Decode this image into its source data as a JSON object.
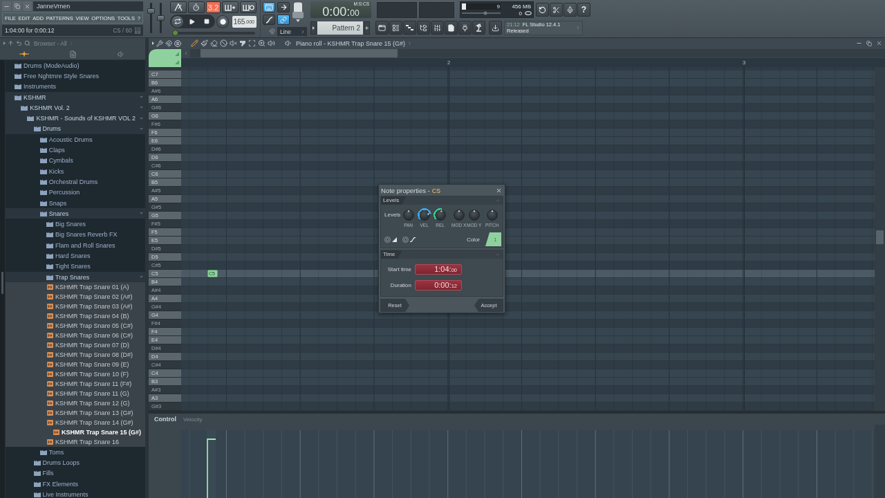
{
  "title_bar": {
    "user": "JanneVrnen"
  },
  "menu": [
    "FILE",
    "EDIT",
    "ADD",
    "PATTERNS",
    "VIEW",
    "OPTIONS",
    "TOOLS",
    "?"
  ],
  "hint_bar": {
    "text": "1:04:00 for 0:00:12",
    "note": "C5 / 60"
  },
  "master_sliders": [
    {
      "level": 0.78
    },
    {
      "level": 0.5
    }
  ],
  "transport": {
    "toggles": [
      {
        "on": false
      },
      {
        "on": false
      },
      {
        "label": "3.2",
        "on": true
      },
      {
        "on": false
      },
      {
        "on": false
      }
    ],
    "tempo": {
      "value": "165",
      "fraction": ".000"
    },
    "song_position": {
      "level": 0
    }
  },
  "snap": {
    "toggles": [
      {
        "on": true
      },
      {
        "on": false
      },
      {
        "on": false
      },
      {
        "on": true
      }
    ],
    "mode": "Line"
  },
  "time_display": {
    "value": "0:00:",
    "fraction": "00",
    "format": "M:S:CS"
  },
  "performance": {
    "cpu_meter": {
      "level": 0.1
    },
    "cpu": "9",
    "memory": "456 MB",
    "polyphony": "0"
  },
  "help": "?",
  "pattern": "Pattern 2",
  "hint_panel": {
    "time": "21:12",
    "title": "FL Studio 12.4.1",
    "status": "Released"
  },
  "browser": {
    "title": "Browser - All",
    "tabs": [
      {
        "selected": true
      },
      {
        "selected": false
      },
      {
        "selected": false
      }
    ],
    "tree": [
      {
        "label": "Drums (ModeAudio)",
        "kind": "folder",
        "expanded": false
      },
      {
        "label": "Free Nghtmre Style Snares",
        "kind": "folder",
        "expanded": false
      },
      {
        "label": "Instruments",
        "kind": "folder",
        "expanded": false
      },
      {
        "label": "KSHMR",
        "kind": "folder",
        "expanded": true,
        "children": [
          {
            "label": "KSHMR Vol. 2",
            "kind": "folder",
            "expanded": true,
            "children": [
              {
                "label": "KSHMR - Sounds of KSHMR VOL 2",
                "kind": "folder",
                "expanded": true,
                "children": [
                  {
                    "label": "Drums",
                    "kind": "folder",
                    "expanded": true,
                    "children": [
                      {
                        "label": "Acoustic Drums",
                        "kind": "folder",
                        "expanded": false
                      },
                      {
                        "label": "Claps",
                        "kind": "folder",
                        "expanded": false
                      },
                      {
                        "label": "Cymbals",
                        "kind": "folder",
                        "expanded": false
                      },
                      {
                        "label": "Kicks",
                        "kind": "folder",
                        "expanded": false
                      },
                      {
                        "label": "Orchestral Drums",
                        "kind": "folder",
                        "expanded": false
                      },
                      {
                        "label": "Percussion",
                        "kind": "folder",
                        "expanded": false
                      },
                      {
                        "label": "Snaps",
                        "kind": "folder",
                        "expanded": false
                      },
                      {
                        "label": "Snares",
                        "kind": "folder",
                        "expanded": true,
                        "children": [
                          {
                            "label": "Big Snares",
                            "kind": "folder",
                            "expanded": false
                          },
                          {
                            "label": "Big Snares Reverb FX",
                            "kind": "folder",
                            "expanded": false
                          },
                          {
                            "label": "Flam and Roll Snares",
                            "kind": "folder",
                            "expanded": false
                          },
                          {
                            "label": "Hard Snares",
                            "kind": "folder",
                            "expanded": false
                          },
                          {
                            "label": "Tight Snares",
                            "kind": "folder",
                            "expanded": false
                          },
                          {
                            "label": "Trap Snares",
                            "kind": "folder",
                            "expanded": true,
                            "children": [
                              {
                                "label": "KSHMR Trap Snare 01 (A)",
                                "kind": "file",
                                "selected": false
                              },
                              {
                                "label": "KSHMR Trap Snare 02 (A#)",
                                "kind": "file",
                                "selected": false
                              },
                              {
                                "label": "KSHMR Trap Snare 03 (A#)",
                                "kind": "file",
                                "selected": false
                              },
                              {
                                "label": "KSHMR Trap Snare 04 (B)",
                                "kind": "file",
                                "selected": false
                              },
                              {
                                "label": "KSHMR Trap Snare 05 (C#)",
                                "kind": "file",
                                "selected": false
                              },
                              {
                                "label": "KSHMR Trap Snare 06 (C#)",
                                "kind": "file",
                                "selected": false
                              },
                              {
                                "label": "KSHMR Trap Snare 07 (D)",
                                "kind": "file",
                                "selected": false
                              },
                              {
                                "label": "KSHMR Trap Snare 08 (D#)",
                                "kind": "file",
                                "selected": false
                              },
                              {
                                "label": "KSHMR Trap Snare 09 (E)",
                                "kind": "file",
                                "selected": false
                              },
                              {
                                "label": "KSHMR Trap Snare 10 (F)",
                                "kind": "file",
                                "selected": false
                              },
                              {
                                "label": "KSHMR Trap Snare 11 (F#)",
                                "kind": "file",
                                "selected": false
                              },
                              {
                                "label": "KSHMR Trap Snare 11 (G)",
                                "kind": "file",
                                "selected": false
                              },
                              {
                                "label": "KSHMR Trap Snare 12 (G)",
                                "kind": "file",
                                "selected": false
                              },
                              {
                                "label": "KSHMR Trap Snare 13 (G#)",
                                "kind": "file",
                                "selected": false
                              },
                              {
                                "label": "KSHMR Trap Snare 14 (G#)",
                                "kind": "file",
                                "selected": false
                              },
                              {
                                "label": "KSHMR Trap Snare 15 (G#)",
                                "kind": "file",
                                "selected": true
                              },
                              {
                                "label": "KSHMR Trap Snare 16",
                                "kind": "file",
                                "selected": false
                              }
                            ]
                          }
                        ]
                      },
                      {
                        "label": "Toms",
                        "kind": "folder",
                        "expanded": false
                      }
                    ]
                  },
                  {
                    "label": "Drums Loops",
                    "kind": "folder",
                    "expanded": false
                  },
                  {
                    "label": "Fills",
                    "kind": "folder",
                    "expanded": false
                  },
                  {
                    "label": "FX Elements",
                    "kind": "folder",
                    "expanded": false
                  },
                  {
                    "label": "Live Instruments",
                    "kind": "folder",
                    "expanded": false
                  }
                ]
              }
            ]
          }
        ]
      }
    ]
  },
  "piano_roll": {
    "title": "Piano roll - KSHMR Trap Snare 15 (G#)",
    "tools": [
      {
        "selected": true
      },
      {
        "selected": false
      },
      {
        "selected": false
      },
      {
        "selected": false
      },
      {
        "selected": false
      },
      {
        "selected": false
      },
      {
        "selected": false
      },
      {
        "selected": false
      },
      {
        "selected": false
      }
    ],
    "bars": [
      "2",
      "3"
    ],
    "keys": [
      {
        "label": "C7",
        "kind": "white",
        "selected": false
      },
      {
        "label": "B6",
        "kind": "white",
        "selected": false
      },
      {
        "label": "A#6",
        "kind": "black",
        "selected": false
      },
      {
        "label": "A6",
        "kind": "white",
        "selected": false
      },
      {
        "label": "G#6",
        "kind": "black",
        "selected": false
      },
      {
        "label": "G6",
        "kind": "white",
        "selected": false
      },
      {
        "label": "F#6",
        "kind": "black",
        "selected": false
      },
      {
        "label": "F6",
        "kind": "white",
        "selected": false
      },
      {
        "label": "E6",
        "kind": "white",
        "selected": false
      },
      {
        "label": "D#6",
        "kind": "black",
        "selected": false
      },
      {
        "label": "D6",
        "kind": "white",
        "selected": false
      },
      {
        "label": "C#6",
        "kind": "black",
        "selected": false
      },
      {
        "label": "C6",
        "kind": "white",
        "selected": false
      },
      {
        "label": "B5",
        "kind": "white",
        "selected": false
      },
      {
        "label": "A#5",
        "kind": "black",
        "selected": false
      },
      {
        "label": "A5",
        "kind": "white",
        "selected": false
      },
      {
        "label": "G#5",
        "kind": "black",
        "selected": false
      },
      {
        "label": "G5",
        "kind": "white",
        "selected": false
      },
      {
        "label": "F#5",
        "kind": "black",
        "selected": false
      },
      {
        "label": "F5",
        "kind": "white",
        "selected": false
      },
      {
        "label": "E5",
        "kind": "white",
        "selected": false
      },
      {
        "label": "D#5",
        "kind": "black",
        "selected": false
      },
      {
        "label": "D5",
        "kind": "white",
        "selected": false
      },
      {
        "label": "C#5",
        "kind": "black",
        "selected": false
      },
      {
        "label": "C5",
        "kind": "white",
        "selected": true,
        "notes": [
          {
            "label": "C5"
          }
        ]
      },
      {
        "label": "B4",
        "kind": "white",
        "selected": false
      },
      {
        "label": "A#4",
        "kind": "black",
        "selected": false
      },
      {
        "label": "A4",
        "kind": "white",
        "selected": false
      },
      {
        "label": "G#4",
        "kind": "black",
        "selected": false
      },
      {
        "label": "G4",
        "kind": "white",
        "selected": false
      },
      {
        "label": "F#4",
        "kind": "black",
        "selected": false
      },
      {
        "label": "F4",
        "kind": "white",
        "selected": false
      },
      {
        "label": "E4",
        "kind": "white",
        "selected": false
      },
      {
        "label": "D#4",
        "kind": "black",
        "selected": false
      },
      {
        "label": "D4",
        "kind": "white",
        "selected": false
      },
      {
        "label": "C#4",
        "kind": "black",
        "selected": false
      },
      {
        "label": "C4",
        "kind": "white",
        "selected": false
      },
      {
        "label": "B3",
        "kind": "white",
        "selected": false
      },
      {
        "label": "A#3",
        "kind": "black",
        "selected": false
      },
      {
        "label": "A3",
        "kind": "white",
        "selected": false
      },
      {
        "label": "G#3",
        "kind": "black",
        "selected": false
      }
    ],
    "control": {
      "title": "Control",
      "lane": "Velocity",
      "velocity": {
        "level": 0.88
      }
    }
  },
  "note_properties": {
    "title": "Note properties -",
    "note": "C5",
    "levels": {
      "title": "Levels",
      "expanded": true,
      "label": "Levels",
      "knobs": [
        {
          "label": "PAN",
          "level": 0.5
        },
        {
          "label": "VEL",
          "level": 0.78,
          "color": "#3ea6e0"
        },
        {
          "label": "REL",
          "level": 0.55,
          "color": "#3ad08a"
        },
        {
          "label": "MOD X",
          "level": 0.5
        },
        {
          "label": "MOD Y",
          "level": 0.5
        },
        {
          "label": "PITCH",
          "level": 0.5
        }
      ],
      "toggles": [
        {
          "on": false
        },
        {
          "on": false
        }
      ],
      "color_label": "Color",
      "color_value": "1"
    },
    "time": {
      "title": "Time",
      "expanded": true,
      "fields": [
        {
          "label": "Start time",
          "value": "1:04:",
          "fraction": "00"
        },
        {
          "label": "Duration",
          "value": "0:00:",
          "fraction": "12"
        }
      ]
    },
    "buttons": [
      "Reset",
      "Accept"
    ]
  }
}
